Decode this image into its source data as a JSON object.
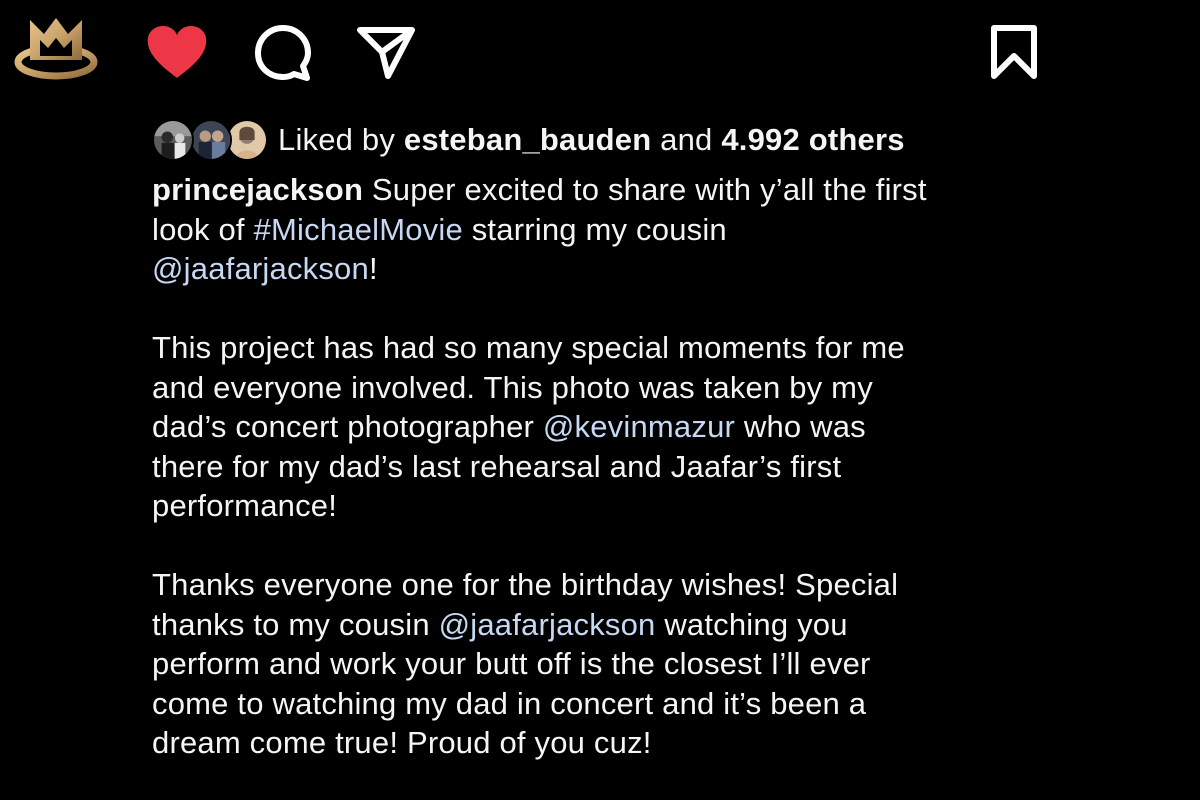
{
  "watermark": {
    "icon": "crown-logo-icon"
  },
  "actions": {
    "like": {
      "icon": "heart-icon",
      "active": true,
      "color": "#ed3747"
    },
    "comment": {
      "icon": "comment-icon"
    },
    "share": {
      "icon": "paper-plane-icon"
    },
    "save": {
      "icon": "bookmark-icon"
    }
  },
  "likes": {
    "prefix": "Liked by",
    "username": "esteban_bauden",
    "conjunction": "and",
    "count_text": "4.992 others"
  },
  "caption": {
    "author": "princejackson",
    "lines": [
      [
        {
          "text": "Super excited to share with y’all the first",
          "type": "text"
        }
      ],
      [
        {
          "text": "look of ",
          "type": "text"
        },
        {
          "text": "#MichaelMovie",
          "type": "hashtag"
        },
        {
          "text": " starring my cousin",
          "type": "text"
        }
      ],
      [
        {
          "text": "@jaafarjackson",
          "type": "mention"
        },
        {
          "text": "!",
          "type": "text"
        }
      ],
      [],
      [
        {
          "text": "This project has had so many special moments for me",
          "type": "text"
        }
      ],
      [
        {
          "text": "and everyone involved. This photo was taken by my",
          "type": "text"
        }
      ],
      [
        {
          "text": "dad’s concert photographer ",
          "type": "text"
        },
        {
          "text": "@kevinmazur",
          "type": "mention"
        },
        {
          "text": " who was",
          "type": "text"
        }
      ],
      [
        {
          "text": "there for my dad’s last rehearsal and Jaafar’s first",
          "type": "text"
        }
      ],
      [
        {
          "text": "performance!",
          "type": "text"
        }
      ],
      [],
      [
        {
          "text": "Thanks everyone one for the birthday wishes! Special",
          "type": "text"
        }
      ],
      [
        {
          "text": "thanks to my cousin ",
          "type": "text"
        },
        {
          "text": "@jaafarjackson",
          "type": "mention"
        },
        {
          "text": " watching you",
          "type": "text"
        }
      ],
      [
        {
          "text": "perform and work your butt off is the closest I’ll ever",
          "type": "text"
        }
      ],
      [
        {
          "text": "come to watching my dad in concert and it’s been a",
          "type": "text"
        }
      ],
      [
        {
          "text": "dream come true! Proud of you cuz!",
          "type": "text"
        }
      ]
    ]
  },
  "colors": {
    "background": "#000000",
    "text": "#f5f5f5",
    "link": "#c7d8f3",
    "like": "#ed3747",
    "logo_gold": "#c9a36a"
  }
}
